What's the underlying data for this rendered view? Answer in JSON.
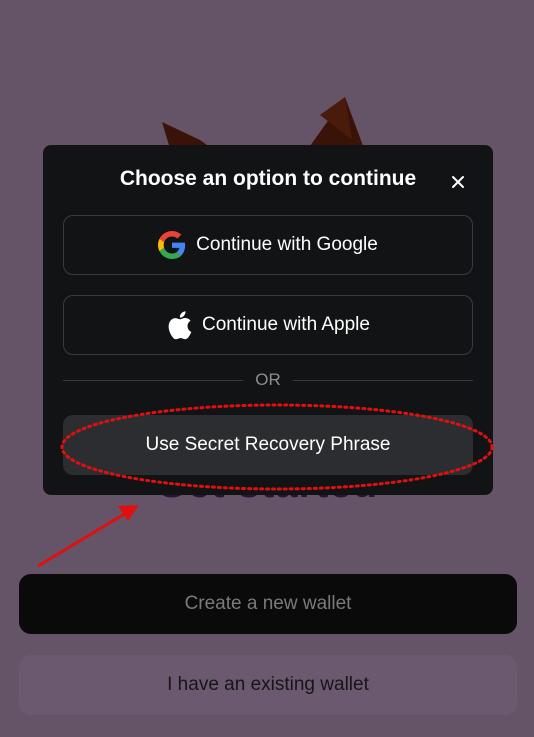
{
  "background": {
    "title": "Get started",
    "create_wallet_label": "Create a new wallet",
    "existing_wallet_label": "I have an existing wallet"
  },
  "modal": {
    "title": "Choose an option to continue",
    "close_icon": "close-icon",
    "google_label": "Continue with Google",
    "apple_label": "Continue with Apple",
    "divider_text": "OR",
    "srp_label": "Use Secret Recovery Phrase"
  },
  "colors": {
    "page_bg": "#655368",
    "modal_bg": "#121314",
    "annotation_red": "#e01010"
  }
}
